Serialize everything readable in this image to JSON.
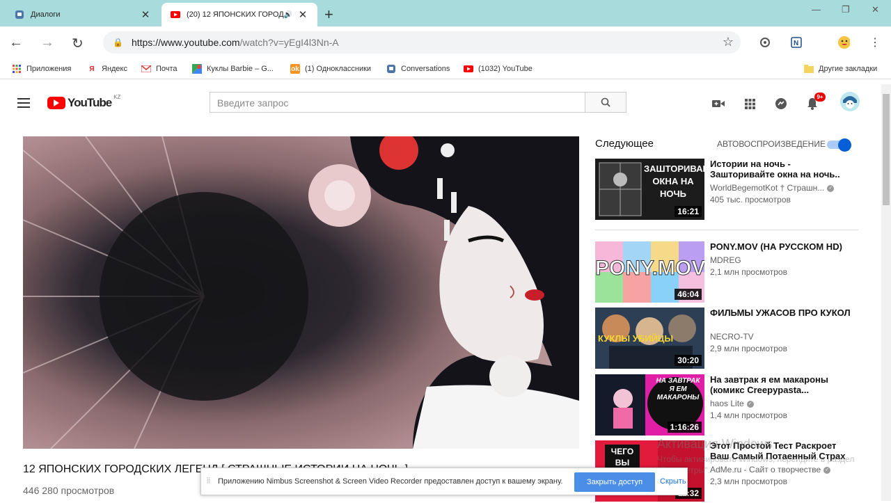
{
  "tabs": [
    {
      "title": "Диалоги",
      "close": "✕"
    },
    {
      "title": "(20) 12 ЯПОНСКИХ ГОРОД",
      "audio": "🔊",
      "close": "✕"
    }
  ],
  "new_tab": "+",
  "address": {
    "host": "https://www.youtube.com",
    "path": "/watch?v=yEgI4l3Nn-A"
  },
  "bookmarks": [
    {
      "label": "Приложения"
    },
    {
      "label": "Яндекс"
    },
    {
      "label": "Почта"
    },
    {
      "label": "Куклы Barbie – G..."
    },
    {
      "label": "(1) Одноклассники"
    },
    {
      "label": "Conversations"
    },
    {
      "label": "(1032) YouTube"
    },
    {
      "label": "Другие закладки"
    }
  ],
  "youtube": {
    "logo_text": "YouTube",
    "region": "KZ",
    "search_placeholder": "Введите запрос",
    "notifications": "9+"
  },
  "video": {
    "title": "12 ЯПОНСКИХ ГОРОДСКИХ ЛЕГЕНД [ СТРАШНЫЕ ИСТОРИИ НА НОЧЬ ]",
    "views": "446 280 просмотров"
  },
  "sidebar": {
    "up_next": "Следующее",
    "autoplay": "АВТОВОСПРОИЗВЕДЕНИЕ",
    "autoplay_on": true,
    "items": [
      {
        "title": "Истории на ночь - Зашторивайте окна на ночь..",
        "channel": "WorldBegemotKot † Страшн...",
        "verified": true,
        "views": "405 тыс. просмотров",
        "duration": "16:21",
        "thumb_text": "ЗАШТОРИВАЙТЕ ОКНА НА НОЧЬ"
      },
      {
        "title": "PONY.MOV (НА РУССКОМ HD)",
        "channel": "MDREG",
        "verified": false,
        "views": "2,1 млн просмотров",
        "duration": "46:04",
        "thumb_text": "PONY.MOV"
      },
      {
        "title": "ФИЛЬМЫ УЖАСОВ ПРО КУКОЛ",
        "channel": "NECRO-TV",
        "verified": false,
        "views": "2,9 млн просмотров",
        "duration": "30:20",
        "thumb_text": "КУКЛЫ УБИЙЦЫ"
      },
      {
        "title": "На завтрак я ем макароны (комикс Creepypasta...",
        "channel": "haos Lite",
        "verified": true,
        "views": "1,4 млн просмотров",
        "duration": "1:16:26",
        "thumb_text": "НА ЗАВТРАК Я ЕМ МАКАРОНЫ"
      },
      {
        "title": "Этот Простой Тест Раскроет Ваш Самый Потаенный Страх",
        "channel": "AdMe.ru - Сайт о творчестве",
        "verified": true,
        "views": "2,3 млн просмотров",
        "duration": "11:32",
        "thumb_text": "ЧЕГО ВЫ"
      }
    ]
  },
  "infobar": {
    "message": "Приложению Nimbus Screenshot & Screen Video Recorder предоставлен доступ к вашему экрану.",
    "share_button": "Закрыть доступ",
    "hide_button": "Скрыть"
  },
  "watermark": {
    "line1": "Активация Windows",
    "line2": "Чтобы активировать Windows, перейдите в раздел \"Параметры\"."
  }
}
